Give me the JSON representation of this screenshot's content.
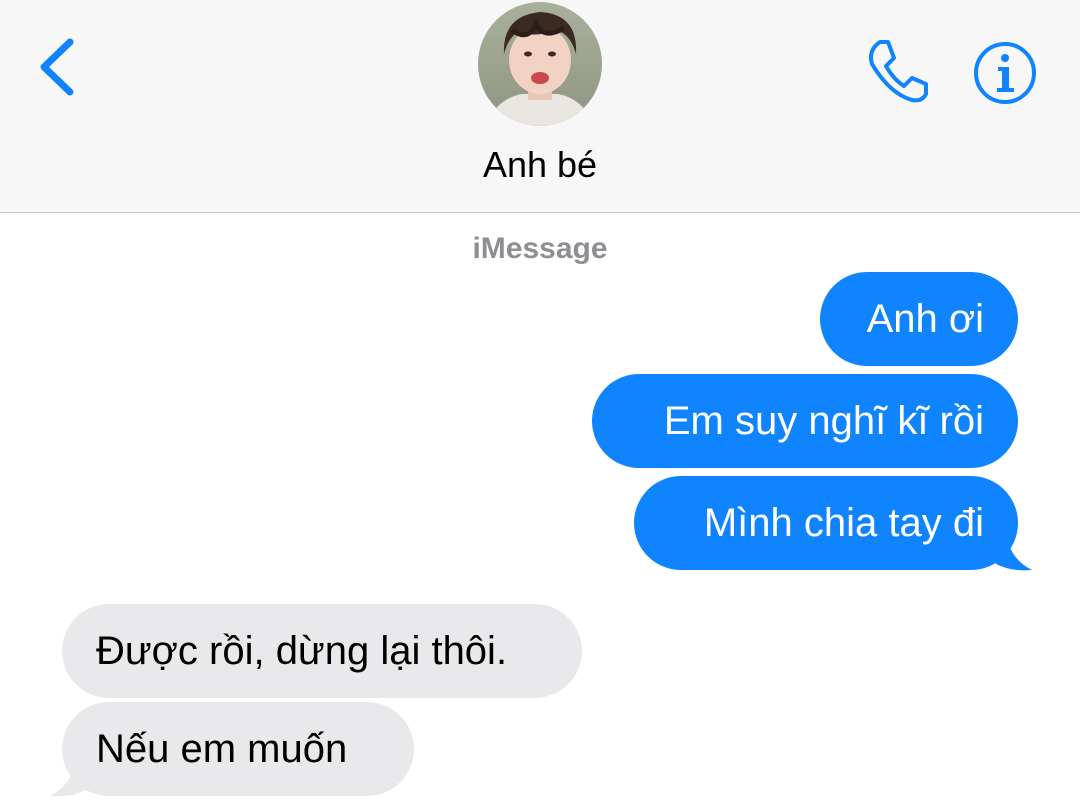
{
  "header": {
    "contact_name": "Anh bé",
    "back_icon": "chevron-left-icon",
    "call_icon": "phone-icon",
    "info_icon": "info-icon",
    "accent_color": "#1083fe"
  },
  "conversation": {
    "service_label": "iMessage",
    "outgoing_color": "#1083fe",
    "incoming_color": "#e9e9eb",
    "messages": [
      {
        "direction": "outgoing",
        "text": "Anh ơi"
      },
      {
        "direction": "outgoing",
        "text": "Em suy nghĩ kĩ rồi"
      },
      {
        "direction": "outgoing",
        "text": "Mình chia tay đi"
      },
      {
        "direction": "incoming",
        "text": "Được rồi, dừng lại thôi."
      },
      {
        "direction": "incoming",
        "text": "Nếu em muốn"
      }
    ]
  }
}
